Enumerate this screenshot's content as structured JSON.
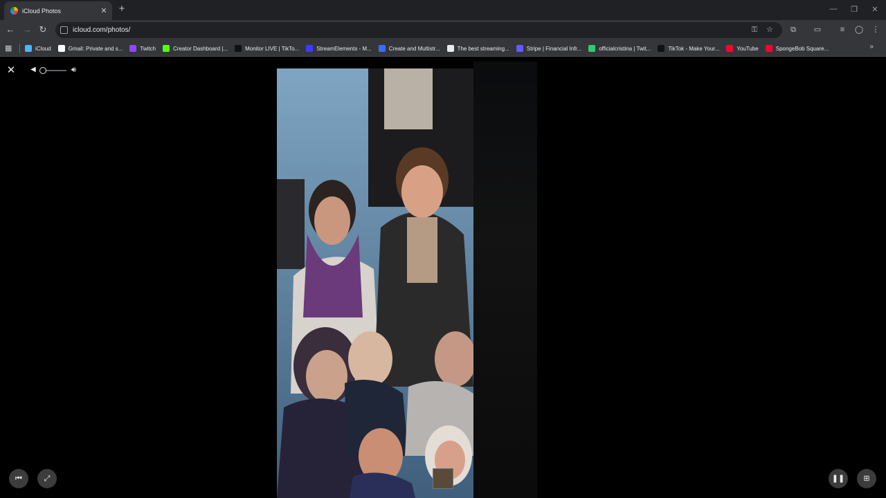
{
  "browser": {
    "tab_title": "iCloud Photos",
    "tab_close": "✕",
    "new_tab": "+",
    "url": "icloud.com/photos/",
    "window_controls": [
      "—",
      "❐",
      "✕"
    ],
    "nav": {
      "back": "←",
      "forward": "→",
      "reload": "↻"
    }
  },
  "bookmarks": [
    {
      "label": "iCloud",
      "icon": "icloud-icon",
      "color": "#4fb3ff"
    },
    {
      "label": "Gmail: Private and s...",
      "icon": "google-icon",
      "color": "#ffffff"
    },
    {
      "label": "Twitch",
      "icon": "twitch-icon",
      "color": "#9146ff"
    },
    {
      "label": "Creator Dashboard |...",
      "icon": "kick-icon",
      "color": "#53fc18"
    },
    {
      "label": "Monitor LIVE | TikTo...",
      "icon": "tiktok-icon",
      "color": "#111111"
    },
    {
      "label": "StreamElements - M...",
      "icon": "streamelements-icon",
      "color": "#3d3bff"
    },
    {
      "label": "Create and Multistr...",
      "icon": "restream-icon",
      "color": "#3b6cff"
    },
    {
      "label": "The best streaming...",
      "icon": "diamond-icon",
      "color": "#e8eaed"
    },
    {
      "label": "Stripe | Financial Infr...",
      "icon": "stripe-icon",
      "color": "#635bff"
    },
    {
      "label": "officialcristina | Twit...",
      "icon": "twitch-alt-icon",
      "color": "#2ecc71"
    },
    {
      "label": "TikTok - Make Your...",
      "icon": "tiktok-icon",
      "color": "#111111"
    },
    {
      "label": "YouTube",
      "icon": "youtube-icon",
      "color": "#ff0033"
    },
    {
      "label": "SpongeBob Square...",
      "icon": "youtube-icon",
      "color": "#ff0033"
    }
  ],
  "bookmarks_more": "»",
  "viewer": {
    "close": "✕",
    "volume_level": 0.05,
    "play_state": "playing"
  },
  "colors": {
    "tab_bg": "#35363a",
    "strip_bg": "#202124",
    "viewer_bg": "#000000"
  }
}
